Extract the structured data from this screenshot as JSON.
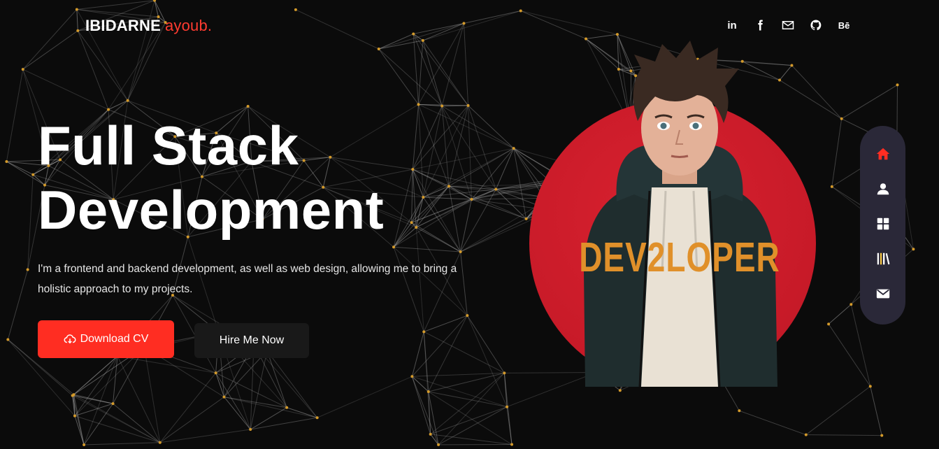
{
  "logo": {
    "first": "IBIDARNE",
    "second": "ayoub."
  },
  "social": {
    "linkedin": "in",
    "behance": "Bē"
  },
  "hero": {
    "title_line1": "Full Stack",
    "title_line2": "Development",
    "description": "I'm a frontend and backend development, as well as web design, allowing me to bring a holistic approach to my projects.",
    "primary_button": "Download CV",
    "secondary_button": "Hire Me Now"
  },
  "avatar": {
    "jacket_text": "DEV2LOPER"
  },
  "sidenav": {
    "items": [
      "home-icon",
      "user-icon",
      "grid-icon",
      "books-icon",
      "mail-icon"
    ]
  },
  "colors": {
    "accent": "#ff2d22",
    "circle": "#c71a28",
    "nav_bg": "#2a2838",
    "background": "#0b0b0b"
  }
}
